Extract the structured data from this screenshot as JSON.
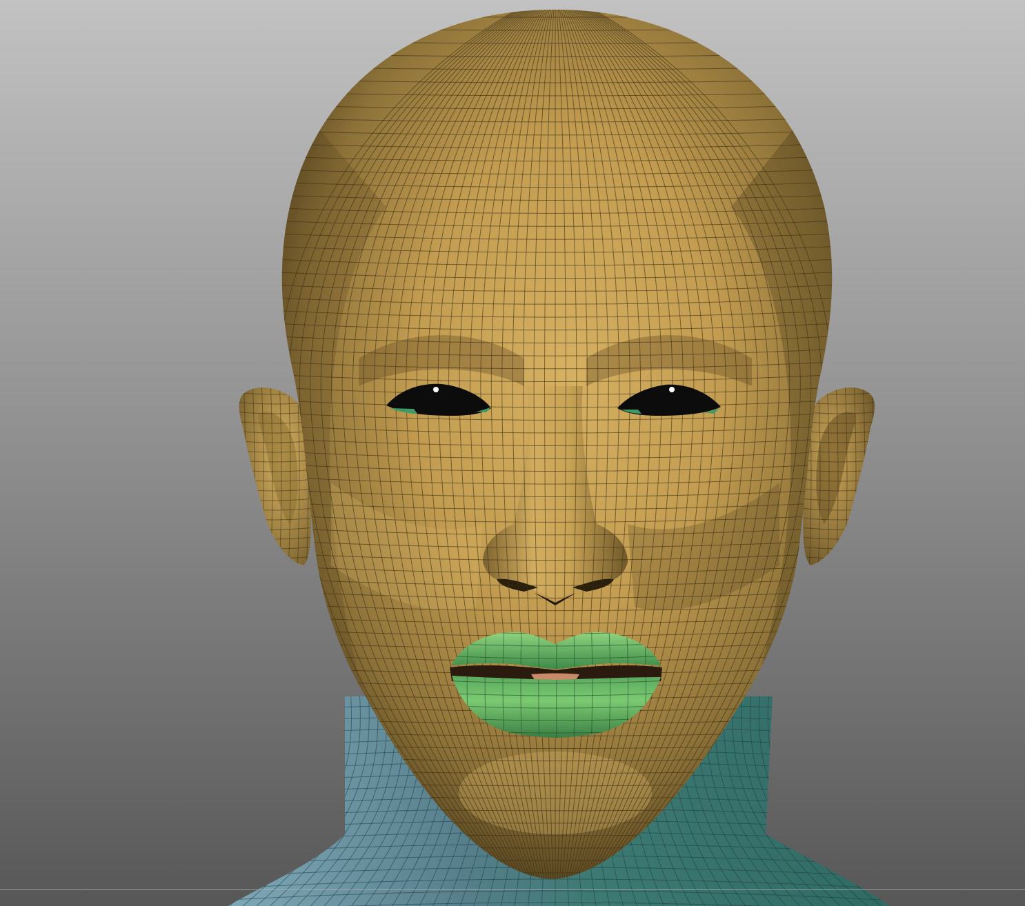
{
  "viewport": {
    "background_top": "#bdbdbd",
    "background_bottom": "#5a5a5a",
    "model": "head-mesh"
  },
  "materials": {
    "skin_light": "#d3ad5c",
    "skin_mid": "#a98a45",
    "skin_dark": "#5e4a22",
    "wire": "#3a2f16",
    "lips": "#6fc26f",
    "lips_dark": "#3e8a48",
    "neck": "#4f8e92",
    "neck_dark": "#2f5d66",
    "eye": "#0c0c0c",
    "eye_highlight": "#ffffff",
    "tear_duct": "#3f9a66"
  },
  "polygroups": [
    "head-polygroup",
    "lips-polygroup",
    "neck-polygroup",
    "eyes-polygroup"
  ]
}
